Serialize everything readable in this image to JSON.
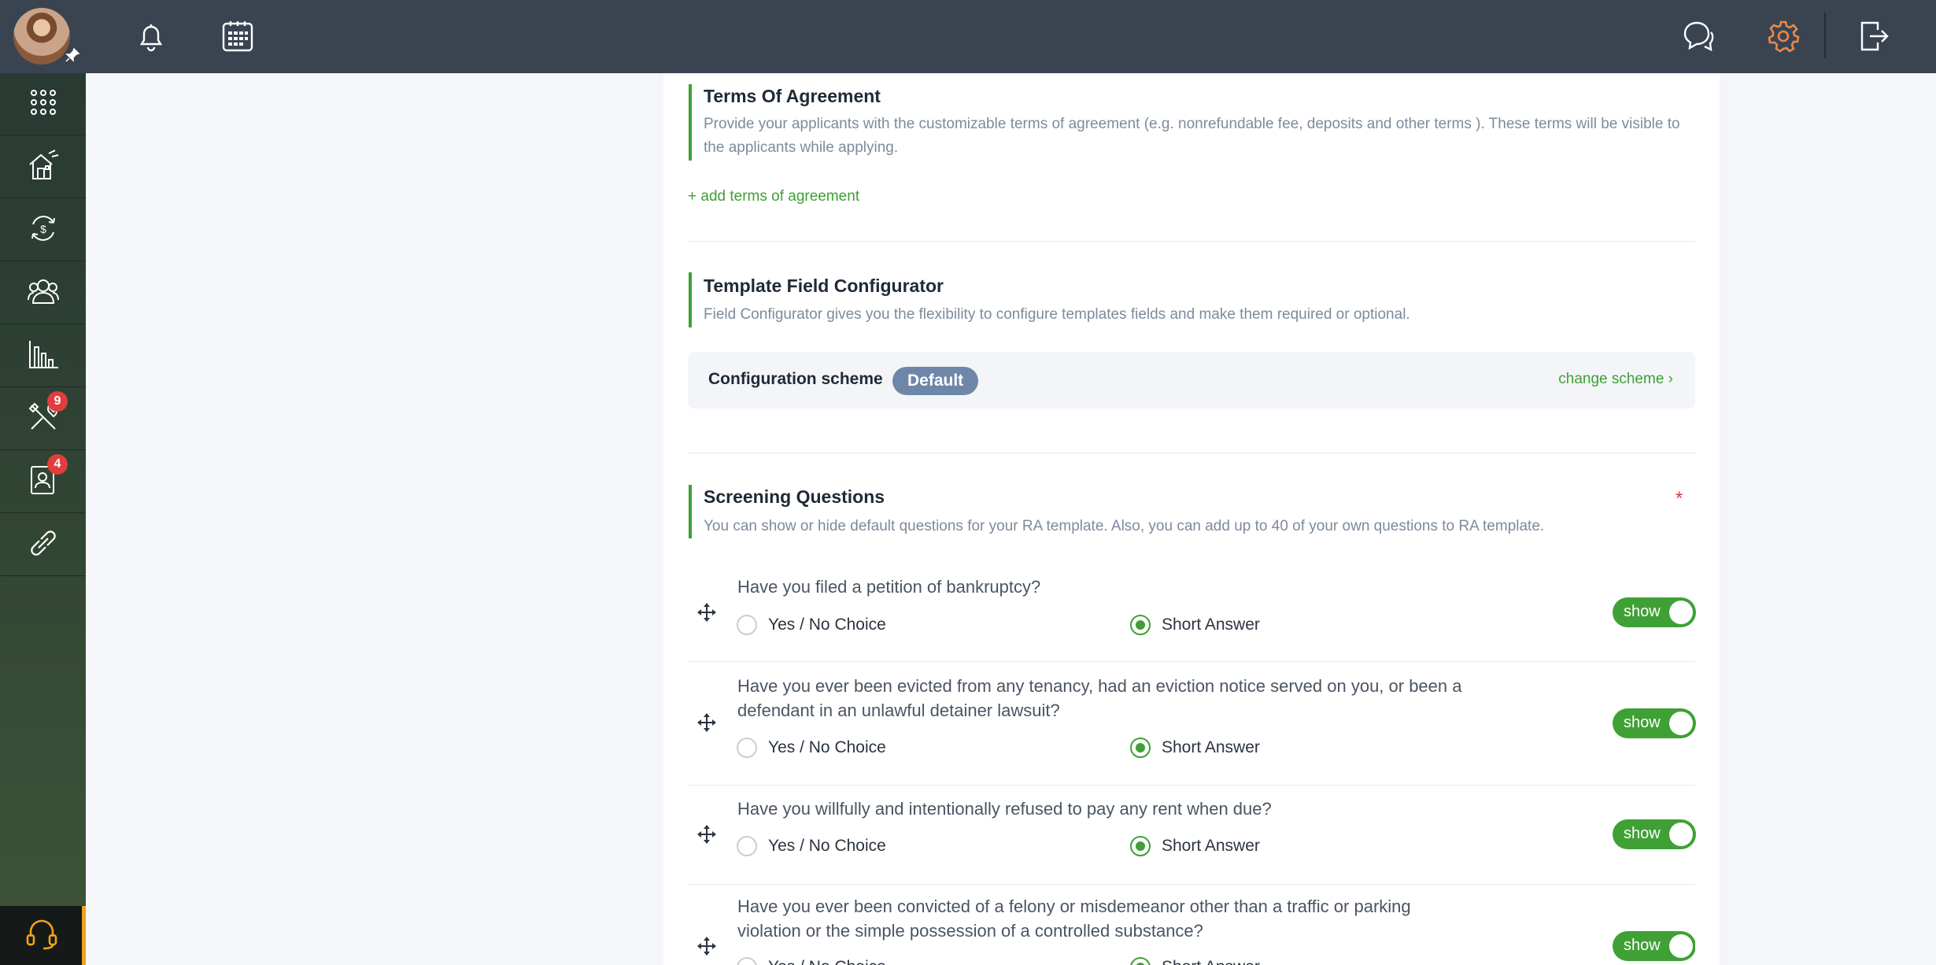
{
  "colors": {
    "accent": "#3fa035",
    "topbar": "#3a4451",
    "danger": "#e03d3d",
    "settings_active": "#e8894a"
  },
  "topbar": {
    "icons": [
      "bell-icon",
      "calendar-icon",
      "chat-icon",
      "gear-icon",
      "logout-icon"
    ]
  },
  "sidebar": {
    "items": [
      {
        "name": "apps-grid-icon"
      },
      {
        "name": "properties-icon"
      },
      {
        "name": "payments-icon"
      },
      {
        "name": "people-icon"
      },
      {
        "name": "reports-icon"
      },
      {
        "name": "maintenance-icon",
        "badge": "9"
      },
      {
        "name": "applications-icon",
        "badge": "4"
      },
      {
        "name": "link-icon"
      }
    ],
    "help_icon": "headset-icon"
  },
  "terms": {
    "title": "Terms Of Agreement",
    "description": "Provide your applicants with the customizable terms of agreement (e.g. nonrefundable fee, deposits and other terms ). These terms will be visible to the applicants while applying.",
    "add_link": "+ add terms of agreement"
  },
  "configurator": {
    "title": "Template Field Configurator",
    "description": "Field Configurator gives you the flexibility to configure templates fields and make them required or optional.",
    "scheme_label": "Configuration scheme",
    "scheme_value": "Default",
    "change_link": "change scheme ›"
  },
  "screening": {
    "title": "Screening Questions",
    "description": "You can show or hide default questions for your RA template. Also, you can add up to 40 of your own questions to RA template.",
    "required_mark": "*",
    "option_yes_no": "Yes / No Choice",
    "option_short": "Short Answer",
    "toggle_label": "show",
    "questions": [
      {
        "text": "Have you filed a petition of bankruptcy?",
        "selected": "short",
        "shown": true
      },
      {
        "text": "Have you ever been evicted from any tenancy, had an eviction notice served on you, or been a defendant in an unlawful detainer lawsuit?",
        "selected": "short",
        "shown": true
      },
      {
        "text": "Have you willfully and intentionally refused to pay any rent when due?",
        "selected": "short",
        "shown": true
      },
      {
        "text": "Have you ever been convicted of a felony or misdemeanor other than a traffic or parking violation or the simple possession of a controlled substance?",
        "selected": "short",
        "shown": true
      }
    ]
  }
}
